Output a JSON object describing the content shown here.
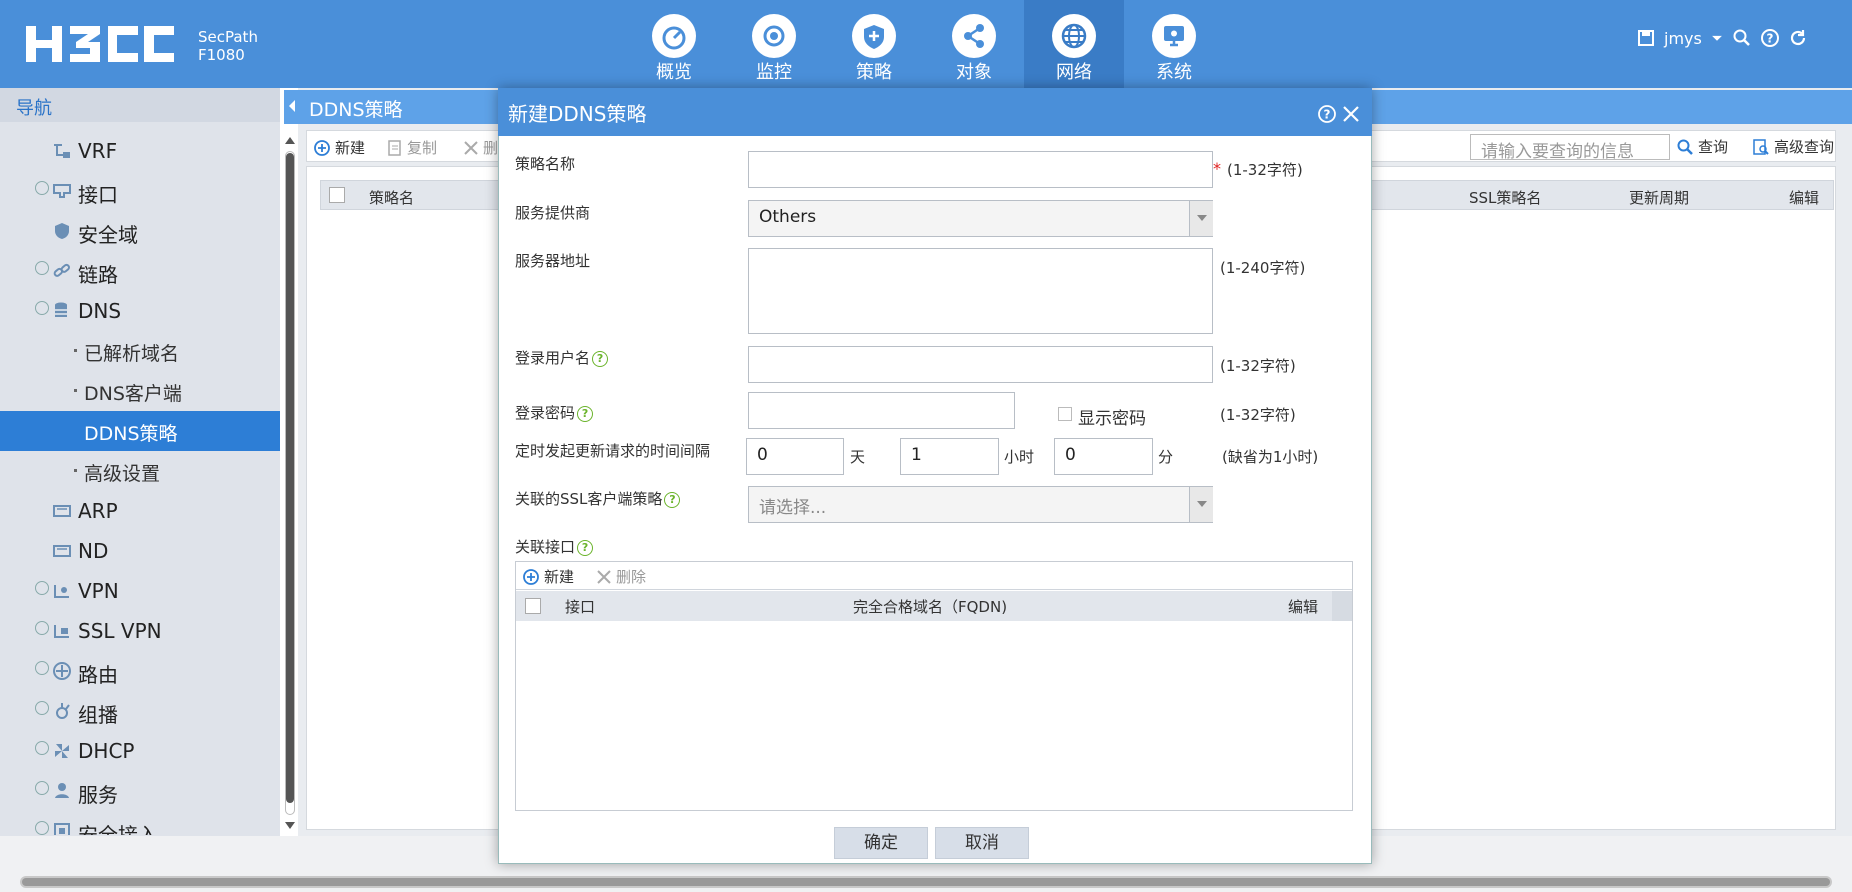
{
  "header": {
    "product_line1": "SecPath",
    "product_line2": "F1080",
    "nav": [
      {
        "label": "概览",
        "icon": "dashboard-gauge-icon"
      },
      {
        "label": "监控",
        "icon": "monitor-eye-icon"
      },
      {
        "label": "策略",
        "icon": "policy-shield-icon"
      },
      {
        "label": "对象",
        "icon": "object-share-icon"
      },
      {
        "label": "网络",
        "icon": "network-globe-icon",
        "active": true
      },
      {
        "label": "系统",
        "icon": "system-monitor-icon"
      }
    ],
    "username": "jmys"
  },
  "sidebar": {
    "title": "导航",
    "items": [
      {
        "label": "VRF",
        "icon": "vrf-icon",
        "expandable": false,
        "level": 1
      },
      {
        "label": "接口",
        "icon": "interface-icon",
        "expandable": true,
        "level": 1
      },
      {
        "label": "安全域",
        "icon": "security-zone-icon",
        "expandable": false,
        "level": 1
      },
      {
        "label": "链路",
        "icon": "link-icon",
        "expandable": true,
        "level": 1
      },
      {
        "label": "DNS",
        "icon": "dns-icon",
        "expandable": true,
        "level": 1
      },
      {
        "label": "已解析域名",
        "level": 2
      },
      {
        "label": "DNS客户端",
        "level": 2
      },
      {
        "label": "DDNS策略",
        "level": 2,
        "active": true
      },
      {
        "label": "高级设置",
        "level": 2
      },
      {
        "label": "ARP",
        "icon": "arp-icon",
        "expandable": false,
        "level": 1
      },
      {
        "label": "ND",
        "icon": "nd-icon",
        "expandable": false,
        "level": 1
      },
      {
        "label": "VPN",
        "icon": "vpn-icon",
        "expandable": true,
        "level": 1
      },
      {
        "label": "SSL VPN",
        "icon": "ssl-vpn-icon",
        "expandable": true,
        "level": 1
      },
      {
        "label": "路由",
        "icon": "route-icon",
        "expandable": true,
        "level": 1
      },
      {
        "label": "组播",
        "icon": "multicast-icon",
        "expandable": true,
        "level": 1
      },
      {
        "label": "DHCP",
        "icon": "dhcp-icon",
        "expandable": true,
        "level": 1
      },
      {
        "label": "服务",
        "icon": "service-icon",
        "expandable": true,
        "level": 1
      },
      {
        "label": "安全接入",
        "icon": "secure-access-icon",
        "expandable": true,
        "level": 1
      }
    ]
  },
  "main": {
    "page_title": "DDNS策略",
    "toolbar": {
      "new": "新建",
      "copy": "复制",
      "delete": "删"
    },
    "search_placeholder": "请输入要查询的信息",
    "query": "查询",
    "advanced_query": "高级查询",
    "columns": {
      "name": "策略名",
      "ssl_policy": "SSL策略名",
      "interval": "更新周期",
      "edit": "编辑"
    }
  },
  "dialog": {
    "title": "新建DDNS策略",
    "fields": {
      "policy_name": {
        "label": "策略名称",
        "value": "",
        "hint": "(1-32字符)"
      },
      "provider": {
        "label": "服务提供商",
        "value": "Others"
      },
      "server_address": {
        "label": "服务器地址",
        "value": "",
        "hint": "(1-240字符)"
      },
      "username": {
        "label": "登录用户名",
        "value": "",
        "hint": "(1-32字符)"
      },
      "password": {
        "label": "登录密码",
        "value": "",
        "show_password": "显示密码",
        "hint": "(1-32字符)"
      },
      "interval": {
        "label": "定时发起更新请求的时间间隔",
        "days": "0",
        "days_unit": "天",
        "hours": "1",
        "hours_unit": "小时",
        "minutes": "0",
        "minutes_unit": "分",
        "hint": "(缺省为1小时)"
      },
      "ssl_policy": {
        "label": "关联的SSL客户端策略",
        "placeholder": "请选择..."
      }
    },
    "interfaces": {
      "label": "关联接口",
      "new": "新建",
      "delete": "删除",
      "col_interface": "接口",
      "col_fqdn": "完全合格域名（FQDN)",
      "col_edit": "编辑"
    },
    "ok": "确定",
    "cancel": "取消"
  },
  "colors": {
    "accent": "#4a8fd9",
    "active_nav": "#3a7cc6",
    "sidebar_active": "#2d7ed6",
    "help_green": "#6bb42c"
  }
}
